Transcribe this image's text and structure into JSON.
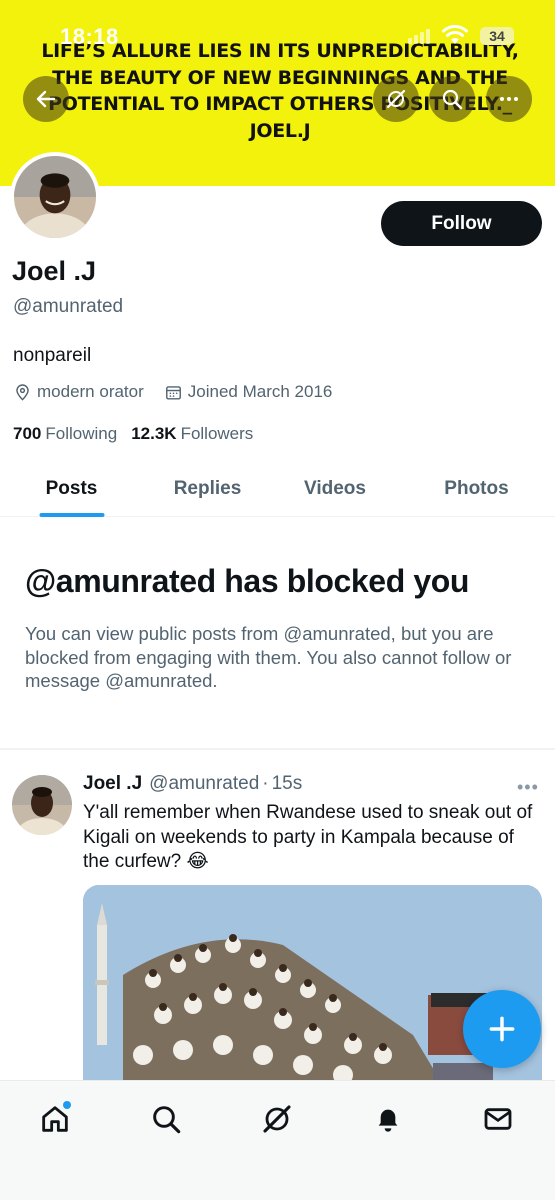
{
  "status_bar": {
    "time": "18:18",
    "battery": "34"
  },
  "banner": {
    "text": "LIFE’S ALLURE LIES IN ITS UNPREDICTABILITY, THE BEAUTY OF NEW BEGINNINGS AND THE POTENTIAL TO IMPACT OTHERS POSITIVELY._ JOEL.J"
  },
  "header_buttons": {
    "back_icon": "arrow-left-icon",
    "grok_icon": "slash-circle-icon",
    "search_icon": "search-icon",
    "more_icon": "more-icon"
  },
  "profile": {
    "display_name": "Joel .J",
    "handle": "@amunrated",
    "follow_label": "Follow",
    "bio": "nonpareil",
    "location": "modern orator",
    "joined": "Joined March 2016",
    "following_count": "700",
    "following_label": "Following",
    "followers_count": "12.3K",
    "followers_label": "Followers"
  },
  "tabs": [
    {
      "label": "Posts",
      "active": true
    },
    {
      "label": "Replies",
      "active": false
    },
    {
      "label": "Videos",
      "active": false
    },
    {
      "label": "Photos",
      "active": false
    }
  ],
  "blocked": {
    "title": "@amunrated has blocked you",
    "description": "You can view public posts from @amunrated, but you are blocked from engaging with them. You also cannot follow or message @amunrated."
  },
  "post": {
    "name": "Joel .J",
    "handle": "@amunrated",
    "dot": "·",
    "time": "15s",
    "more": "•••",
    "text": "Y'all remember when Rwandese used to sneak out of Kigali on weekends to party in Kampala because of the curfew? 😂"
  },
  "fab": {
    "icon": "plus-icon"
  },
  "bottom_nav": [
    {
      "name": "home-icon"
    },
    {
      "name": "search-icon"
    },
    {
      "name": "grok-icon"
    },
    {
      "name": "notifications-icon"
    },
    {
      "name": "messages-icon"
    }
  ],
  "colors": {
    "accent": "#1d9bf0",
    "banner": "#f2f20c",
    "text_primary": "#0f1419",
    "text_secondary": "#536471"
  }
}
